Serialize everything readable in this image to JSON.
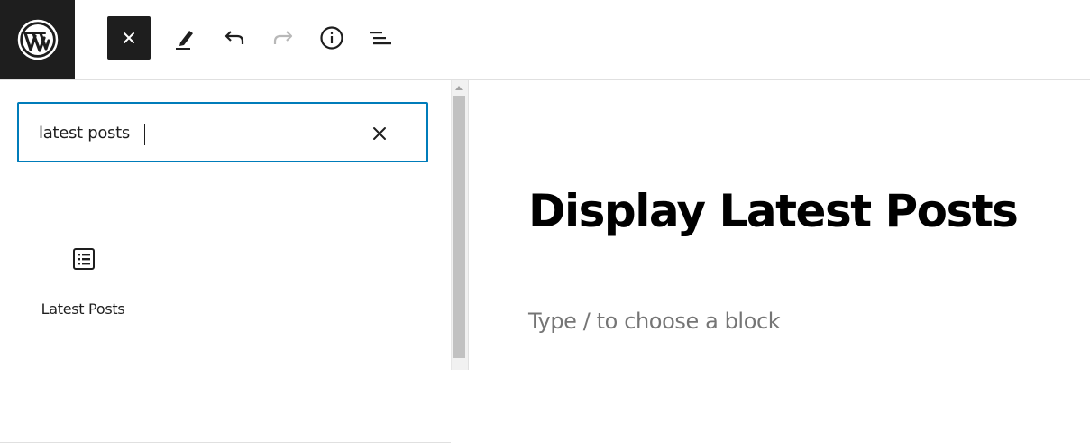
{
  "toolbar": {
    "logo_icon": "wordpress-icon",
    "close_icon": "close-icon",
    "tools_icon": "pencil-icon",
    "undo_icon": "undo-icon",
    "redo_icon": "redo-icon",
    "details_icon": "info-icon",
    "list_view_icon": "list-view-icon"
  },
  "inserter": {
    "search": {
      "value": "latest posts",
      "clear_icon": "close-icon"
    },
    "results": [
      {
        "label": "Latest Posts",
        "icon": "post-list-icon"
      }
    ]
  },
  "editor": {
    "title": "Display Latest Posts",
    "block_placeholder": "Type / to choose a block"
  },
  "colors": {
    "toolbar_dark": "#1e1e1e",
    "focus_blue": "#007cba",
    "placeholder_gray": "#757575"
  }
}
